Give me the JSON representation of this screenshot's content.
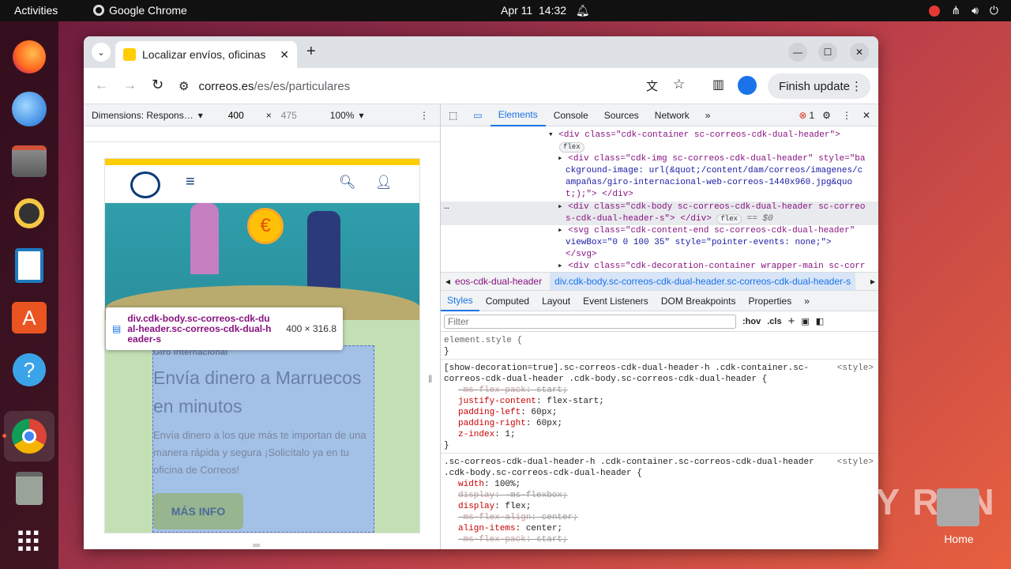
{
  "system": {
    "activities": "Activities",
    "app_name": "Google Chrome",
    "date": "Apr 11",
    "time": "14:32"
  },
  "browser": {
    "tab_title": "Localizar envíos, oficinas",
    "url_domain": "correos.es",
    "url_path": "/es/es/particulares",
    "finish_update": "Finish update"
  },
  "device_toolbar": {
    "dimensions": "Dimensions: Respons…",
    "width": "400",
    "height": "475",
    "zoom": "100%"
  },
  "page": {
    "label": "Giro Internacional",
    "title": "Envía dinero a Marruecos en minutos",
    "body": "Envía dinero a los que más te importan de una manera rápida y segura ¡Solicítalo ya en tu oficina de Correos!",
    "cta": "MÁS INFO"
  },
  "tooltip": {
    "selector": "div.cdk-body.sc-correos-cdk-dual-header.sc-correos-cdk-dual-header-s",
    "size": "400 × 316.8"
  },
  "devtools": {
    "tabs": [
      "Elements",
      "Console",
      "Sources",
      "Network"
    ],
    "error_count": "1",
    "dom_lines": [
      "<div class=\"cdk-container sc-correos-cdk-dual-header\">",
      "flex",
      "<div class=\"cdk-img sc-correos-cdk-dual-header\" style=\"ba",
      "ckground-image: url(&quot;/content/dam/correos/imagenes/c",
      "ampañas/giro-internacional-web-correos-1440x960.jpg&quo",
      "t;);\"> </div>",
      "<div class=\"cdk-body sc-correos-cdk-dual-header sc-correo",
      "s-cdk-dual-header-s\"> </div>",
      "== $0",
      "<svg class=\"cdk-content-end sc-correos-cdk-dual-header\"",
      "viewBox=\"0 0 100 35\" style=\"pointer-events: none;\"> ",
      "</svg>",
      "<div class=\"cdk-decoration-container wrapper-main sc-corr"
    ],
    "breadcrumb_prev": "eos-cdk-dual-header",
    "breadcrumb_active": "div.cdk-body.sc-correos-cdk-dual-header.sc-correos-cdk-dual-header-s",
    "subtabs": [
      "Styles",
      "Computed",
      "Layout",
      "Event Listeners",
      "DOM Breakpoints",
      "Properties"
    ],
    "filter_placeholder": "Filter",
    "hov": ":hov",
    "cls": ".cls",
    "rules": {
      "element_style": "element.style {",
      "close": "}",
      "rule1_selector": "[show-decoration=true].sc-correos-cdk-dual-header-h .cdk-container.sc-correos-cdk-dual-header .cdk-body.sc-correos-cdk-dual-header {",
      "rule1_props": [
        {
          "name": "-ms-flex-pack",
          "value": "start",
          "strike": true
        },
        {
          "name": "justify-content",
          "value": "flex-start",
          "strike": false
        },
        {
          "name": "padding-left",
          "value": "60px",
          "strike": false
        },
        {
          "name": "padding-right",
          "value": "60px",
          "strike": false
        },
        {
          "name": "z-index",
          "value": "1",
          "strike": false
        }
      ],
      "rule2_selector": ".sc-correos-cdk-dual-header-h .cdk-container.sc-correos-cdk-dual-header .cdk-body.sc-correos-cdk-dual-header {",
      "rule2_props": [
        {
          "name": "width",
          "value": "100%",
          "strike": false
        },
        {
          "name": "display",
          "value": "-ms-flexbox",
          "strike": true
        },
        {
          "name": "display",
          "value": "flex",
          "strike": false
        },
        {
          "name": "-ms-flex-align",
          "value": "center",
          "strike": true
        },
        {
          "name": "align-items",
          "value": "center",
          "strike": false
        },
        {
          "name": "-ms-flex-pack",
          "value": "start",
          "strike": true
        }
      ],
      "source": "<style>"
    }
  },
  "desktop": {
    "home": "Home"
  },
  "watermark": "ANY RUN"
}
